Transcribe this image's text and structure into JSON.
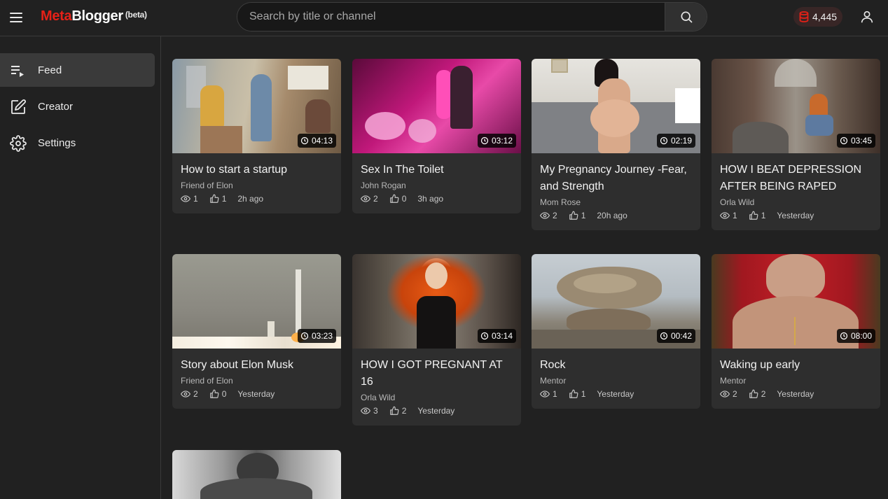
{
  "header": {
    "logo_meta": "Meta",
    "logo_blogger": "Blogger",
    "logo_beta": "(beta)",
    "search_placeholder": "Search by title or channel",
    "credits": "4,445"
  },
  "sidebar": {
    "items": [
      {
        "label": "Feed",
        "icon": "feed-icon",
        "active": true
      },
      {
        "label": "Creator",
        "icon": "edit-icon",
        "active": false
      },
      {
        "label": "Settings",
        "icon": "gear-icon",
        "active": false
      }
    ]
  },
  "videos": [
    {
      "title": "How to start a startup",
      "channel": "Friend of Elon",
      "views": "1",
      "likes": "1",
      "time": "2h ago",
      "duration": "04:13"
    },
    {
      "title": "Sex In The Toilet",
      "channel": "John Rogan",
      "views": "2",
      "likes": "0",
      "time": "3h ago",
      "duration": "03:12"
    },
    {
      "title": "My Pregnancy Journey -Fear, and Strength",
      "channel": "Mom Rose",
      "views": "2",
      "likes": "1",
      "time": "20h ago",
      "duration": "02:19"
    },
    {
      "title": "HOW I BEAT DEPRESSION AFTER BEING RAPED",
      "channel": "Orla Wild",
      "views": "1",
      "likes": "1",
      "time": "Yesterday",
      "duration": "03:45"
    },
    {
      "title": "Story about Elon Musk",
      "channel": "Friend of Elon",
      "views": "2",
      "likes": "0",
      "time": "Yesterday",
      "duration": "03:23"
    },
    {
      "title": "HOW I GOT PREGNANT AT 16",
      "channel": "Orla Wild",
      "views": "3",
      "likes": "2",
      "time": "Yesterday",
      "duration": "03:14"
    },
    {
      "title": "Rock",
      "channel": "Mentor",
      "views": "1",
      "likes": "1",
      "time": "Yesterday",
      "duration": "00:42"
    },
    {
      "title": "Waking up early",
      "channel": "Mentor",
      "views": "2",
      "likes": "2",
      "time": "Yesterday",
      "duration": "08:00"
    }
  ],
  "colors": {
    "brand_red": "#e62117",
    "background": "#212121",
    "card": "#2e2e2e"
  }
}
